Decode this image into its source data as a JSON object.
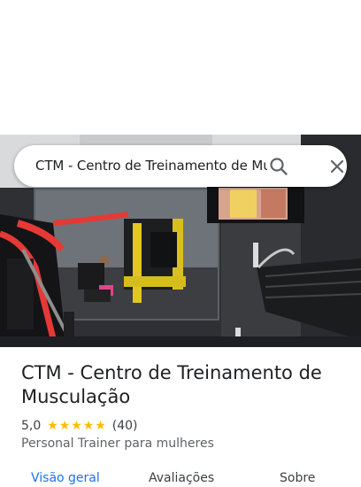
{
  "search": {
    "query": "CTM - Centro de Treinamento de Mu",
    "search_icon": "search-icon",
    "close_icon": "close-icon"
  },
  "photo": {
    "description_icon": "gym-photo"
  },
  "place": {
    "title": "CTM - Centro de Treinamento de Musculação",
    "rating": "5,0",
    "stars": 5,
    "reviews": "(40)",
    "category": "Personal Trainer para mulheres"
  },
  "tabs": [
    {
      "label": "Visão geral",
      "active": true
    },
    {
      "label": "Avaliações",
      "active": false
    },
    {
      "label": "Sobre",
      "active": false
    }
  ],
  "colors": {
    "accent": "#1a73e8",
    "star": "#fbbc04",
    "text": "#202124",
    "secondary_text": "#5f6368"
  }
}
